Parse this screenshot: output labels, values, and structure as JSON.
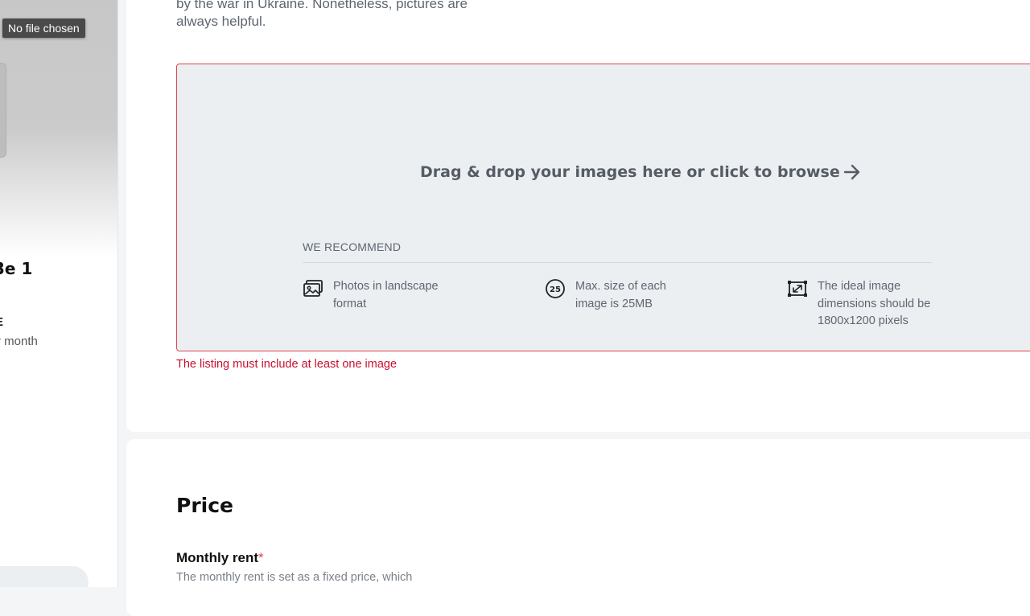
{
  "sidebar": {
    "file_input_tooltip": "No file chosen",
    "listing_title": "3e 1",
    "price_currency": "E",
    "price_period": "r month"
  },
  "photos_section": {
    "intro_text": "by the war in Ukraine. Nonetheless, pictures are always helpful.",
    "dropzone": {
      "prompt": "Drag & drop your images here or click to browse",
      "recommend_heading": "WE RECOMMEND",
      "recommendations": [
        {
          "icon": "landscape-photo-icon",
          "text": "Photos in landscape format"
        },
        {
          "icon": "size-25-icon",
          "icon_text": "25",
          "text": "Max. size of each image is 25MB"
        },
        {
          "icon": "dimensions-icon",
          "text": "The ideal image dimensions should be 1800x1200 pixels"
        }
      ]
    },
    "error": "The listing must include at least one image"
  },
  "price_section": {
    "heading": "Price",
    "monthly_rent_label": "Monthly rent",
    "required_marker": "*",
    "monthly_rent_hint": "The monthly rent is set as a fixed price, which"
  },
  "colors": {
    "error": "#c8102e",
    "dropzone_border": "#e0434c",
    "dropzone_background": "#ebeff2"
  }
}
